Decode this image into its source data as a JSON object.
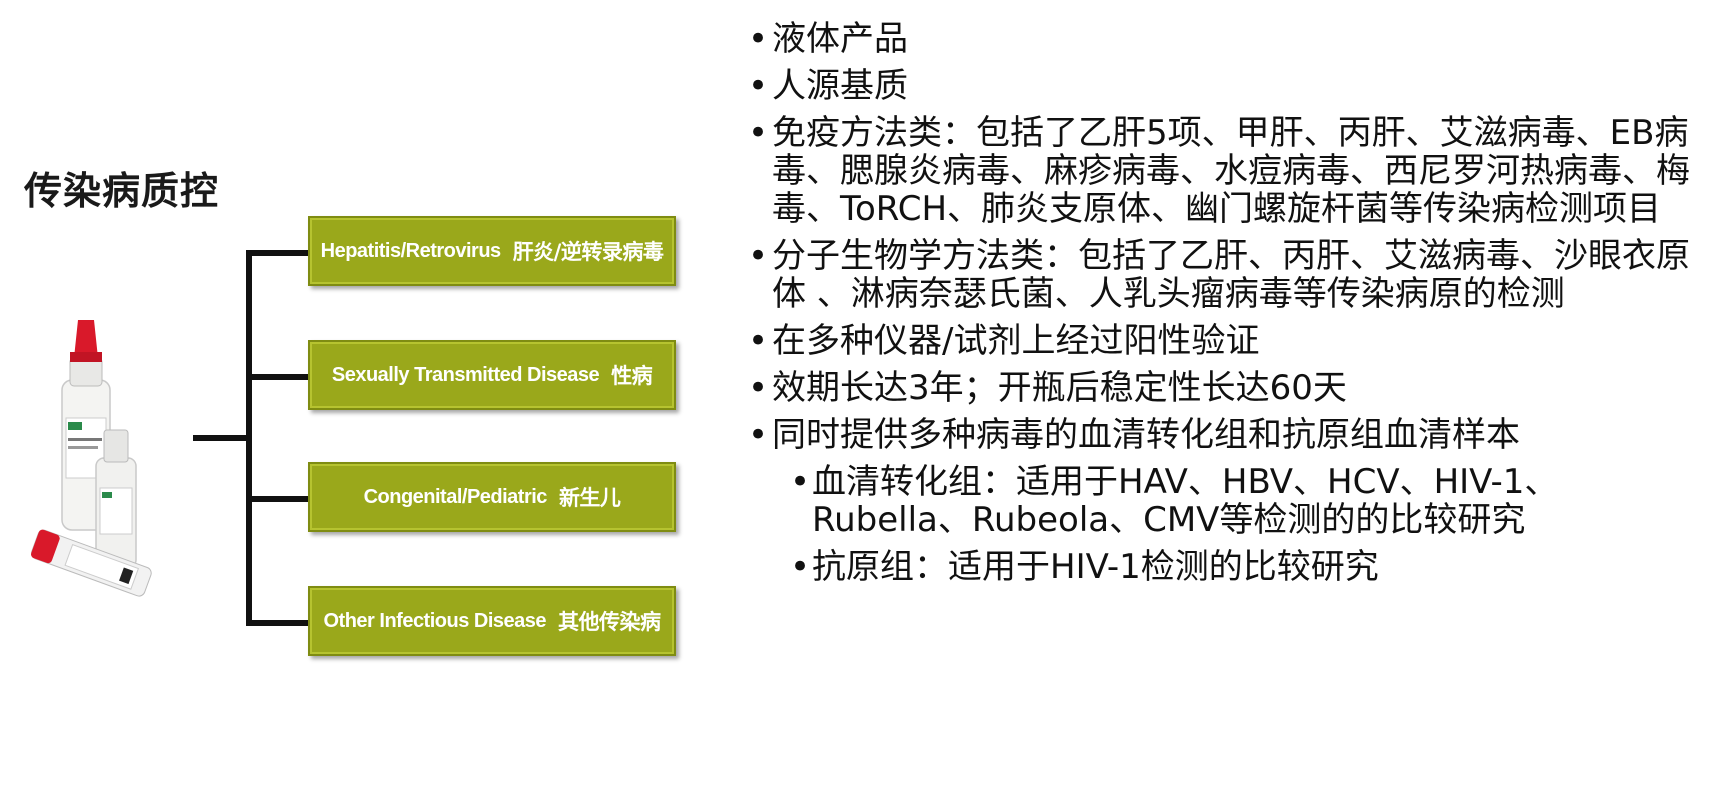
{
  "left_panel": {
    "title": "传染病质控"
  },
  "categories": [
    {
      "en": "Hepatitis/Retrovirus",
      "cn": "肝炎/逆转录病毒"
    },
    {
      "en": "Sexually Transmitted Disease",
      "cn": "性病"
    },
    {
      "en": "Congenital/Pediatric",
      "cn": "新生儿"
    },
    {
      "en": "Other Infectious Disease",
      "cn": "其他传染病"
    }
  ],
  "colors": {
    "category_box": "#9aa81b",
    "bottle_cap": "#d9192a"
  },
  "bullets": [
    "液体产品",
    "人源基质",
    "免疫方法类：包括了乙肝5项、甲肝、丙肝、艾滋病毒、EB病毒、腮腺炎病毒、麻疹病毒、水痘病毒、西尼罗河热病毒、梅毒、ToRCH、肺炎支原体、幽门螺旋杆菌等传染病检测项目",
    "分子生物学方法类：包括了乙肝、丙肝、艾滋病毒、沙眼衣原体 、淋病奈瑟氏菌、人乳头瘤病毒等传染病原的检测",
    "在多种仪器/试剂上经过阳性验证",
    "效期长达3年；开瓶后稳定性长达60天",
    "同时提供多种病毒的血清转化组和抗原组血清样本"
  ],
  "sub_bullets": [
    "血清转化组：适用于HAV、HBV、HCV、HIV-1、Rubella、Rubeola、CMV等检测的的比较研究",
    "抗原组：适用于HIV-1检测的比较研究"
  ]
}
